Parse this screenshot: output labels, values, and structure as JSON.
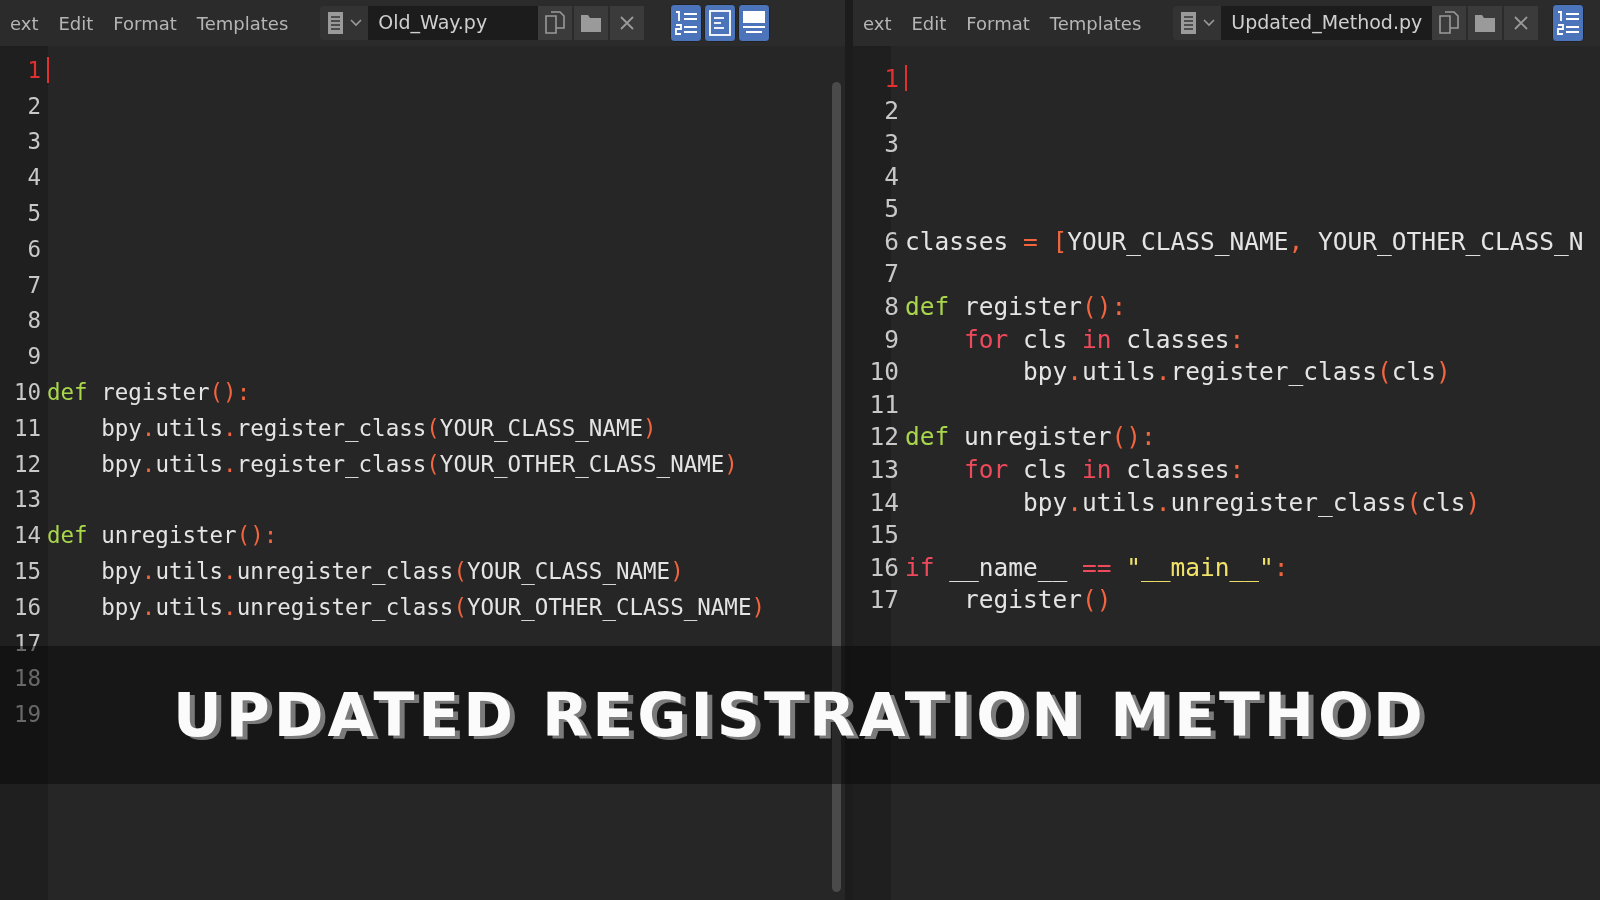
{
  "panes": [
    {
      "menu": [
        "ext",
        "Edit",
        "Format",
        "Templates"
      ],
      "filename": "Old_Way.py",
      "toggles": [
        {
          "kind": "line-numbers",
          "selected": true
        },
        {
          "kind": "word-wrap",
          "selected": true
        },
        {
          "kind": "syntax",
          "selected": true
        }
      ],
      "lines": [
        {
          "number": "1",
          "current": true
        },
        {
          "number": "2",
          "current": false
        },
        {
          "number": "3",
          "current": false
        },
        {
          "number": "4",
          "current": false
        },
        {
          "number": "5",
          "current": false
        },
        {
          "number": "6",
          "current": false
        },
        {
          "number": "7",
          "current": false
        },
        {
          "number": "8",
          "current": false
        },
        {
          "number": "9",
          "current": false
        },
        {
          "number": "10",
          "current": false,
          "tokens": [
            {
              "text": "def",
              "kind": "def"
            },
            {
              "text": " register",
              "kind": "plain"
            },
            {
              "text": "():",
              "kind": "punct"
            }
          ]
        },
        {
          "number": "11",
          "current": false,
          "tokens": [
            {
              "text": "    bpy",
              "kind": "plain"
            },
            {
              "text": ".",
              "kind": "punct"
            },
            {
              "text": "utils",
              "kind": "plain"
            },
            {
              "text": ".",
              "kind": "punct"
            },
            {
              "text": "register_class",
              "kind": "plain"
            },
            {
              "text": "(",
              "kind": "punct"
            },
            {
              "text": "YOUR_CLASS_NAME",
              "kind": "plain"
            },
            {
              "text": ")",
              "kind": "punct"
            }
          ]
        },
        {
          "number": "12",
          "current": false,
          "tokens": [
            {
              "text": "    bpy",
              "kind": "plain"
            },
            {
              "text": ".",
              "kind": "punct"
            },
            {
              "text": "utils",
              "kind": "plain"
            },
            {
              "text": ".",
              "kind": "punct"
            },
            {
              "text": "register_class",
              "kind": "plain"
            },
            {
              "text": "(",
              "kind": "punct"
            },
            {
              "text": "YOUR_OTHER_CLASS_NAME",
              "kind": "plain"
            },
            {
              "text": ")",
              "kind": "punct"
            }
          ]
        },
        {
          "number": "13",
          "current": false
        },
        {
          "number": "14",
          "current": false,
          "tokens": [
            {
              "text": "def",
              "kind": "def"
            },
            {
              "text": " unregister",
              "kind": "plain"
            },
            {
              "text": "():",
              "kind": "punct"
            }
          ]
        },
        {
          "number": "15",
          "current": false,
          "tokens": [
            {
              "text": "    bpy",
              "kind": "plain"
            },
            {
              "text": ".",
              "kind": "punct"
            },
            {
              "text": "utils",
              "kind": "plain"
            },
            {
              "text": ".",
              "kind": "punct"
            },
            {
              "text": "unregister_class",
              "kind": "plain"
            },
            {
              "text": "(",
              "kind": "punct"
            },
            {
              "text": "YOUR_CLASS_NAME",
              "kind": "plain"
            },
            {
              "text": ")",
              "kind": "punct"
            }
          ]
        },
        {
          "number": "16",
          "current": false,
          "tokens": [
            {
              "text": "    bpy",
              "kind": "plain"
            },
            {
              "text": ".",
              "kind": "punct"
            },
            {
              "text": "utils",
              "kind": "plain"
            },
            {
              "text": ".",
              "kind": "punct"
            },
            {
              "text": "unregister_class",
              "kind": "plain"
            },
            {
              "text": "(",
              "kind": "punct"
            },
            {
              "text": "YOUR_OTHER_CLASS_NAME",
              "kind": "plain"
            },
            {
              "text": ")",
              "kind": "punct"
            }
          ]
        },
        {
          "number": "17",
          "current": false
        },
        {
          "number": "18",
          "current": false
        },
        {
          "number": "19",
          "current": false
        }
      ]
    },
    {
      "menu": [
        "ext",
        "Edit",
        "Format",
        "Templates"
      ],
      "filename": "Updated_Method.py",
      "toggles": [
        {
          "kind": "line-numbers",
          "selected": true
        }
      ],
      "lines": [
        {
          "number": "1",
          "current": true
        },
        {
          "number": "2",
          "current": false
        },
        {
          "number": "3",
          "current": false
        },
        {
          "number": "4",
          "current": false
        },
        {
          "number": "5",
          "current": false
        },
        {
          "number": "6",
          "current": false,
          "tokens": [
            {
              "text": "classes ",
              "kind": "plain"
            },
            {
              "text": "=",
              "kind": "punct"
            },
            {
              "text": " [",
              "kind": "punct"
            },
            {
              "text": "YOUR_CLASS_NAME",
              "kind": "plain"
            },
            {
              "text": ",",
              "kind": "punct"
            },
            {
              "text": " YOUR_OTHER_CLASS_N",
              "kind": "plain"
            }
          ]
        },
        {
          "number": "7",
          "current": false
        },
        {
          "number": "8",
          "current": false,
          "tokens": [
            {
              "text": "def",
              "kind": "def"
            },
            {
              "text": " register",
              "kind": "plain"
            },
            {
              "text": "():",
              "kind": "punct"
            }
          ]
        },
        {
          "number": "9",
          "current": false,
          "tokens": [
            {
              "text": "    for",
              "kind": "control"
            },
            {
              "text": " cls ",
              "kind": "plain"
            },
            {
              "text": "in",
              "kind": "control"
            },
            {
              "text": " classes",
              "kind": "plain"
            },
            {
              "text": ":",
              "kind": "punct"
            }
          ]
        },
        {
          "number": "10",
          "current": false,
          "tokens": [
            {
              "text": "        bpy",
              "kind": "plain"
            },
            {
              "text": ".",
              "kind": "punct"
            },
            {
              "text": "utils",
              "kind": "plain"
            },
            {
              "text": ".",
              "kind": "punct"
            },
            {
              "text": "register_class",
              "kind": "plain"
            },
            {
              "text": "(",
              "kind": "punct"
            },
            {
              "text": "cls",
              "kind": "plain"
            },
            {
              "text": ")",
              "kind": "punct"
            }
          ]
        },
        {
          "number": "11",
          "current": false
        },
        {
          "number": "12",
          "current": false,
          "tokens": [
            {
              "text": "def",
              "kind": "def"
            },
            {
              "text": " unregister",
              "kind": "plain"
            },
            {
              "text": "():",
              "kind": "punct"
            }
          ]
        },
        {
          "number": "13",
          "current": false,
          "tokens": [
            {
              "text": "    for",
              "kind": "control"
            },
            {
              "text": " cls ",
              "kind": "plain"
            },
            {
              "text": "in",
              "kind": "control"
            },
            {
              "text": " classes",
              "kind": "plain"
            },
            {
              "text": ":",
              "kind": "punct"
            }
          ]
        },
        {
          "number": "14",
          "current": false,
          "tokens": [
            {
              "text": "        bpy",
              "kind": "plain"
            },
            {
              "text": ".",
              "kind": "punct"
            },
            {
              "text": "utils",
              "kind": "plain"
            },
            {
              "text": ".",
              "kind": "punct"
            },
            {
              "text": "unregister_class",
              "kind": "plain"
            },
            {
              "text": "(",
              "kind": "punct"
            },
            {
              "text": "cls",
              "kind": "plain"
            },
            {
              "text": ")",
              "kind": "punct"
            }
          ]
        },
        {
          "number": "15",
          "current": false
        },
        {
          "number": "16",
          "current": false,
          "tokens": [
            {
              "text": "if",
              "kind": "control"
            },
            {
              "text": " __name__ ",
              "kind": "plain"
            },
            {
              "text": "==",
              "kind": "control"
            },
            {
              "text": " \"__main__\"",
              "kind": "string"
            },
            {
              "text": ":",
              "kind": "punct"
            }
          ]
        },
        {
          "number": "17",
          "current": false,
          "tokens": [
            {
              "text": "    register",
              "kind": "plain"
            },
            {
              "text": "()",
              "kind": "punct"
            }
          ]
        }
      ]
    }
  ],
  "banner": {
    "title": "UPDATED REGISTRATION METHOD"
  }
}
